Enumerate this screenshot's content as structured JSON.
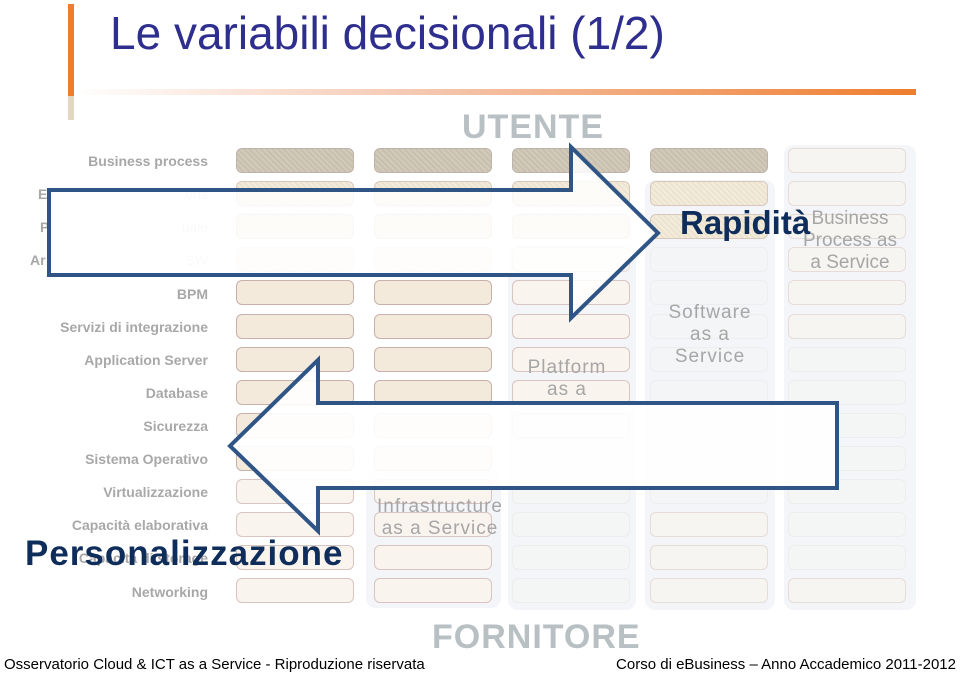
{
  "slide": {
    "title": "Le variabili decisionali (1/2)",
    "top_label": "UTENTE",
    "bottom_label": "FORNITORE"
  },
  "layers": [
    "Business process",
    "Enterprise applications",
    "Personale",
    "Architetture SW",
    "BPM",
    "Servizi di integrazione",
    "Application Server",
    "Database",
    "Sicurezza",
    "Sistema Operativo",
    "Virtualizzazione",
    "Capacità elaborativa",
    "Capacità di storage",
    "Networking"
  ],
  "layers_visible_text": {
    "enterprise_fragment_left": "E",
    "enterprise_fragment_right": "ons",
    "personale_fragment_left": "P",
    "personale_fragment_right": "uale",
    "architetture_fragment_left": "Ar",
    "architetture_fragment_right": "SW"
  },
  "service_models": {
    "iaas": "Infrastructure as a Service",
    "paas": "Platform as a",
    "saas": "Software as a Service",
    "bpaas": "Business Process as a Service"
  },
  "service_models_lines": {
    "iaas": [
      "Infrastructure",
      "as a Service"
    ],
    "paas": [
      "Platform",
      "as a"
    ],
    "saas": [
      "Software",
      "as a",
      "Service"
    ],
    "bpaas": [
      "Business",
      "Process as",
      "a Service"
    ]
  },
  "arrows": {
    "right": {
      "label": "Rapidità",
      "direction": "right"
    },
    "left": {
      "label": "Personalizzazione",
      "direction": "left"
    }
  },
  "colors": {
    "title": "#2e2e8e",
    "accent_orange": "#ee7d2e",
    "arrow_stroke": "#2f5486",
    "arrow_label": "#0e2d5a",
    "layer_label": "#a8a8a8"
  },
  "footer": {
    "left": "Osservatorio Cloud & ICT as a Service - Riproduzione riservata",
    "right": "Corso di eBusiness – Anno Accademico 2011-2012"
  }
}
